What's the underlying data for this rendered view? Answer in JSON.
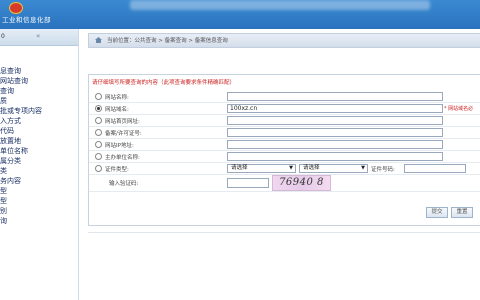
{
  "header": {
    "org_name": "工业和信息化部"
  },
  "sidebar": {
    "head_label": "0",
    "collapse_glyph": "«",
    "items": [
      "息查询",
      "网站查询",
      "查询",
      "质",
      "批或专项内容",
      "入方式",
      "代码",
      "放置地",
      "单位名称",
      "属分类",
      "类",
      "务内容",
      "型",
      "型",
      "别",
      "询"
    ]
  },
  "breadcrumb": {
    "text": "当前位置：公共查询  >  备案查询  >  备案信息查询"
  },
  "form": {
    "notice": "请仔细填写所要查询的内容（此项查询要求条件精确匹配）",
    "rows": [
      {
        "label": "网站名称:",
        "value": "",
        "checked": false
      },
      {
        "label": "网站域名:",
        "value": "100xz.cn",
        "checked": true,
        "hint": "* 网站域名必"
      },
      {
        "label": "网站首页网址:",
        "value": "",
        "checked": false
      },
      {
        "label": "备案/许可证号:",
        "value": "",
        "checked": false
      },
      {
        "label": "网站IP地址:",
        "value": "",
        "checked": false
      },
      {
        "label": "主办单位名称:",
        "value": "",
        "checked": false
      }
    ],
    "cert_row": {
      "label": "证件类型:",
      "select1": "请选择",
      "select2": "请选择",
      "cert_no_label": "证件号码:"
    },
    "captcha": {
      "label": "输入验证码:",
      "image_text": "76940 8"
    },
    "buttons": {
      "submit": "提交",
      "reset": "重置"
    }
  }
}
